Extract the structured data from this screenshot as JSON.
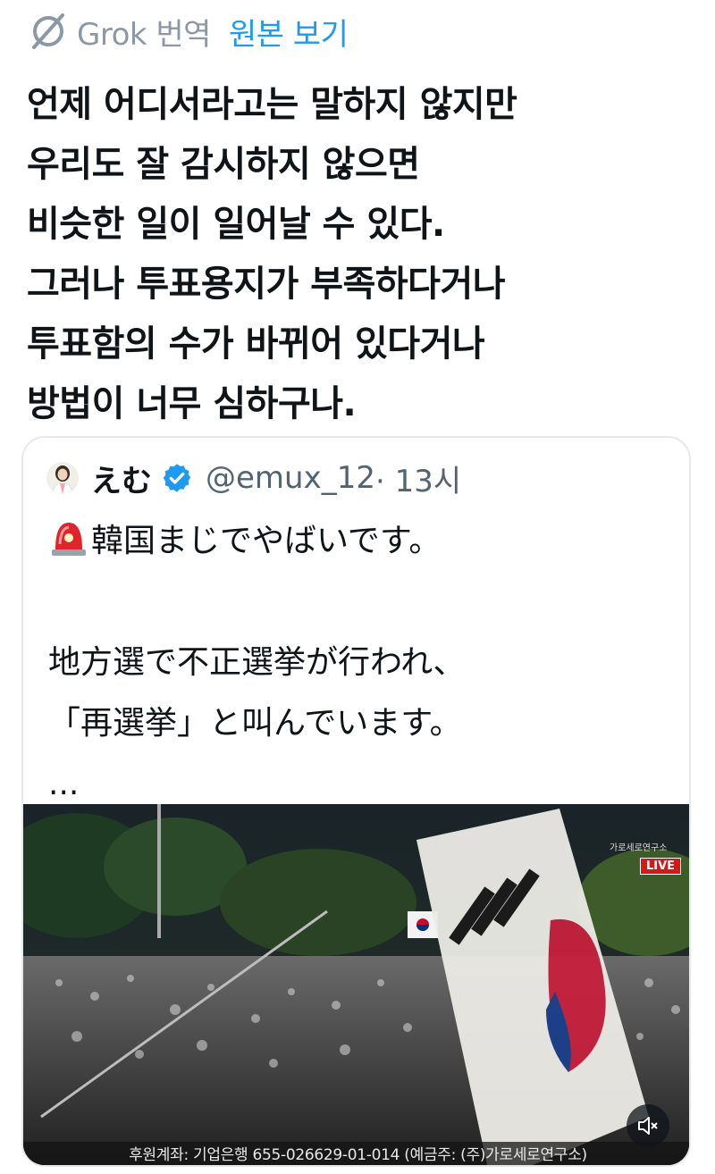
{
  "translation_bar": {
    "icon": "grok-icon",
    "label": "Grok 번역",
    "show_original": "원본 보기"
  },
  "tweet": {
    "lines": [
      "언제 어디서라고는 말하지 않지만",
      "우리도 잘 감시하지 않으면",
      "비슷한 일이 일어날 수 있다.",
      "그러나 투표용지가 부족하다거나",
      "투표함의 수가 바뀌어 있다거나",
      "방법이 너무 심하구나."
    ]
  },
  "quote": {
    "author_name": "えむ",
    "verified": true,
    "handle": "@emux_12",
    "time": " · 13시",
    "siren_icon": "rotating-light-icon",
    "line1": "韓国まじでやばいです。",
    "line2": "地方選で不正選挙が行われ、",
    "line3": "「再選挙」と叫んでいます。",
    "ellipsis": "...",
    "media": {
      "live_badge": "LIVE",
      "channel": "가로세로연구소",
      "donation_caption": "후원계좌: 기업은행 655-026629-01-014 (예금주: (주)가로세로연구소)",
      "mute_icon": "speaker-muted-icon"
    }
  },
  "colors": {
    "link": "#1d9bf0",
    "muted": "#536471",
    "verified": "#1d9bf0"
  }
}
